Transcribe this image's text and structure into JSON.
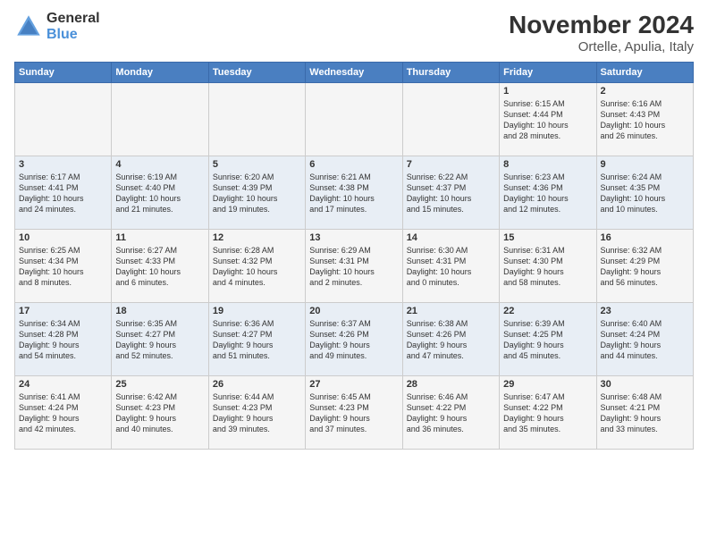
{
  "logo": {
    "general": "General",
    "blue": "Blue"
  },
  "title": "November 2024",
  "subtitle": "Ortelle, Apulia, Italy",
  "days_of_week": [
    "Sunday",
    "Monday",
    "Tuesday",
    "Wednesday",
    "Thursday",
    "Friday",
    "Saturday"
  ],
  "weeks": [
    [
      {
        "day": "",
        "info": ""
      },
      {
        "day": "",
        "info": ""
      },
      {
        "day": "",
        "info": ""
      },
      {
        "day": "",
        "info": ""
      },
      {
        "day": "",
        "info": ""
      },
      {
        "day": "1",
        "info": "Sunrise: 6:15 AM\nSunset: 4:44 PM\nDaylight: 10 hours\nand 28 minutes."
      },
      {
        "day": "2",
        "info": "Sunrise: 6:16 AM\nSunset: 4:43 PM\nDaylight: 10 hours\nand 26 minutes."
      }
    ],
    [
      {
        "day": "3",
        "info": "Sunrise: 6:17 AM\nSunset: 4:41 PM\nDaylight: 10 hours\nand 24 minutes."
      },
      {
        "day": "4",
        "info": "Sunrise: 6:19 AM\nSunset: 4:40 PM\nDaylight: 10 hours\nand 21 minutes."
      },
      {
        "day": "5",
        "info": "Sunrise: 6:20 AM\nSunset: 4:39 PM\nDaylight: 10 hours\nand 19 minutes."
      },
      {
        "day": "6",
        "info": "Sunrise: 6:21 AM\nSunset: 4:38 PM\nDaylight: 10 hours\nand 17 minutes."
      },
      {
        "day": "7",
        "info": "Sunrise: 6:22 AM\nSunset: 4:37 PM\nDaylight: 10 hours\nand 15 minutes."
      },
      {
        "day": "8",
        "info": "Sunrise: 6:23 AM\nSunset: 4:36 PM\nDaylight: 10 hours\nand 12 minutes."
      },
      {
        "day": "9",
        "info": "Sunrise: 6:24 AM\nSunset: 4:35 PM\nDaylight: 10 hours\nand 10 minutes."
      }
    ],
    [
      {
        "day": "10",
        "info": "Sunrise: 6:25 AM\nSunset: 4:34 PM\nDaylight: 10 hours\nand 8 minutes."
      },
      {
        "day": "11",
        "info": "Sunrise: 6:27 AM\nSunset: 4:33 PM\nDaylight: 10 hours\nand 6 minutes."
      },
      {
        "day": "12",
        "info": "Sunrise: 6:28 AM\nSunset: 4:32 PM\nDaylight: 10 hours\nand 4 minutes."
      },
      {
        "day": "13",
        "info": "Sunrise: 6:29 AM\nSunset: 4:31 PM\nDaylight: 10 hours\nand 2 minutes."
      },
      {
        "day": "14",
        "info": "Sunrise: 6:30 AM\nSunset: 4:31 PM\nDaylight: 10 hours\nand 0 minutes."
      },
      {
        "day": "15",
        "info": "Sunrise: 6:31 AM\nSunset: 4:30 PM\nDaylight: 9 hours\nand 58 minutes."
      },
      {
        "day": "16",
        "info": "Sunrise: 6:32 AM\nSunset: 4:29 PM\nDaylight: 9 hours\nand 56 minutes."
      }
    ],
    [
      {
        "day": "17",
        "info": "Sunrise: 6:34 AM\nSunset: 4:28 PM\nDaylight: 9 hours\nand 54 minutes."
      },
      {
        "day": "18",
        "info": "Sunrise: 6:35 AM\nSunset: 4:27 PM\nDaylight: 9 hours\nand 52 minutes."
      },
      {
        "day": "19",
        "info": "Sunrise: 6:36 AM\nSunset: 4:27 PM\nDaylight: 9 hours\nand 51 minutes."
      },
      {
        "day": "20",
        "info": "Sunrise: 6:37 AM\nSunset: 4:26 PM\nDaylight: 9 hours\nand 49 minutes."
      },
      {
        "day": "21",
        "info": "Sunrise: 6:38 AM\nSunset: 4:26 PM\nDaylight: 9 hours\nand 47 minutes."
      },
      {
        "day": "22",
        "info": "Sunrise: 6:39 AM\nSunset: 4:25 PM\nDaylight: 9 hours\nand 45 minutes."
      },
      {
        "day": "23",
        "info": "Sunrise: 6:40 AM\nSunset: 4:24 PM\nDaylight: 9 hours\nand 44 minutes."
      }
    ],
    [
      {
        "day": "24",
        "info": "Sunrise: 6:41 AM\nSunset: 4:24 PM\nDaylight: 9 hours\nand 42 minutes."
      },
      {
        "day": "25",
        "info": "Sunrise: 6:42 AM\nSunset: 4:23 PM\nDaylight: 9 hours\nand 40 minutes."
      },
      {
        "day": "26",
        "info": "Sunrise: 6:44 AM\nSunset: 4:23 PM\nDaylight: 9 hours\nand 39 minutes."
      },
      {
        "day": "27",
        "info": "Sunrise: 6:45 AM\nSunset: 4:23 PM\nDaylight: 9 hours\nand 37 minutes."
      },
      {
        "day": "28",
        "info": "Sunrise: 6:46 AM\nSunset: 4:22 PM\nDaylight: 9 hours\nand 36 minutes."
      },
      {
        "day": "29",
        "info": "Sunrise: 6:47 AM\nSunset: 4:22 PM\nDaylight: 9 hours\nand 35 minutes."
      },
      {
        "day": "30",
        "info": "Sunrise: 6:48 AM\nSunset: 4:21 PM\nDaylight: 9 hours\nand 33 minutes."
      }
    ]
  ]
}
